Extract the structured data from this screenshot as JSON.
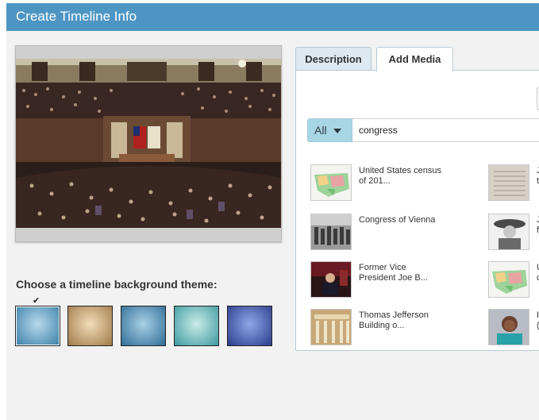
{
  "dialog": {
    "title": "Create Timeline Info"
  },
  "theme_picker": {
    "heading": "Choose a timeline background theme:",
    "check_glyph": "✔",
    "selected_index": 0,
    "swatch_colors": [
      [
        "#b7d9ec",
        "#3b7fa8"
      ],
      [
        "#f2ddb9",
        "#a07a48"
      ],
      [
        "#a9d0e6",
        "#2f6d97"
      ],
      [
        "#c9ebe8",
        "#3e9aa0"
      ],
      [
        "#8fa7e8",
        "#2a3c8c"
      ]
    ]
  },
  "tabs": [
    {
      "label": "Description",
      "active": false
    },
    {
      "label": "Add Media",
      "active": true
    }
  ],
  "search": {
    "filter_label": "All",
    "query": "congress"
  },
  "results": [
    {
      "label_line1": "United States census",
      "label_line2": "of 201...",
      "thumb": "map"
    },
    {
      "label_line1": "Congress of Vienna",
      "label_line2": "",
      "thumb": "painting"
    },
    {
      "label_line1": "Former Vice",
      "label_line2": "President Joe B...",
      "thumb": "portrait-dark"
    },
    {
      "label_line1": "Thomas Jefferson",
      "label_line2": "Building o...",
      "thumb": "building"
    }
  ],
  "results_col2": [
    {
      "label_line1": "J",
      "label_line2": "t",
      "thumb": "paper"
    },
    {
      "label_line1": "J",
      "label_line2": "f",
      "thumb": "portrait-bw"
    },
    {
      "label_line1": "U",
      "label_line2": "c",
      "thumb": "map"
    },
    {
      "label_line1": "I",
      "label_line2": "(",
      "thumb": "portrait-color"
    }
  ],
  "colors": {
    "titlebar": "#4d96c4",
    "filter_button": "#a9d6e4"
  }
}
